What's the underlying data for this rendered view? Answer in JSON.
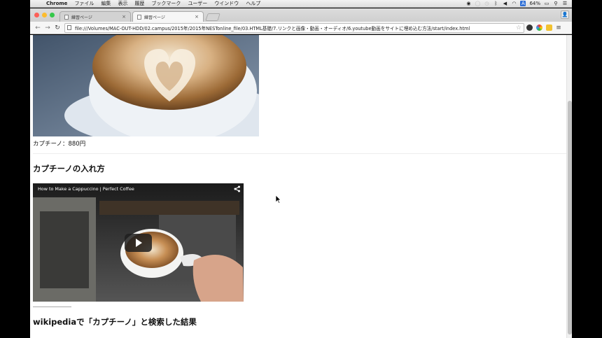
{
  "menubar": {
    "app_name": "Chrome",
    "items": [
      "ファイル",
      "編集",
      "表示",
      "履歴",
      "ブックマーク",
      "ユーザー",
      "ウインドウ",
      "ヘルプ"
    ],
    "battery": "64%"
  },
  "tabs": [
    {
      "title": "練習ページ",
      "active": false
    },
    {
      "title": "練習ページ",
      "active": true
    }
  ],
  "toolbar": {
    "url": "file:///Volumes/MAC-OUT-HDD/02.campus/2015年/2015年NESTonline_file/03.HTML基礎/7.リンクと画像・動画・オーディオ/6.youtube動画をサイトに埋め込む方法/start/index.html"
  },
  "page": {
    "image_caption": "カプチーノ：880円",
    "heading_brew": "カプチーノの入れ方",
    "video_title": "How to Make a Cappuccino | Perfect Coffee",
    "heading_wiki": "wikipediaで「カプチーノ」と検索した結果"
  },
  "colors": {
    "close": "#fc5f57",
    "minimize": "#fdbc2e",
    "zoom": "#34c84a"
  }
}
